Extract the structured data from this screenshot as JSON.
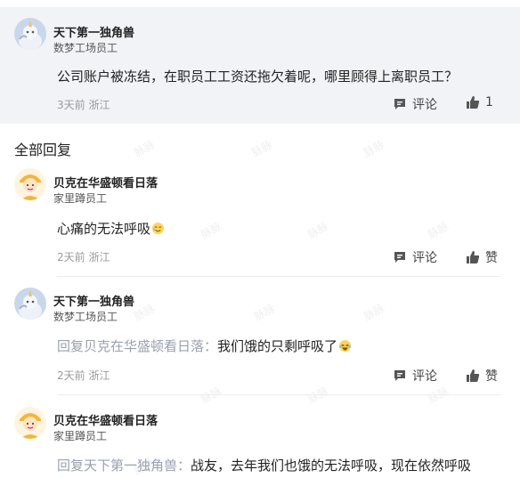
{
  "post": {
    "author": "天下第一独角兽",
    "company": "数梦工场员工",
    "text": "公司账户被冻结，在职员工工资还拖欠着呢，哪里顾得上离职员工？",
    "time": "3天前",
    "location": "浙江",
    "comment_label": "评论",
    "like_count": "1"
  },
  "section_title": "全部回复",
  "watermark": "脉脉",
  "replies": [
    {
      "author": "贝克在华盛顿看日落",
      "company": "家里蹲员工",
      "prefix": "",
      "text": "心痛的无法呼吸",
      "time": "2天前",
      "location": "浙江",
      "comment_label": "评论",
      "like_label": "赞"
    },
    {
      "author": "天下第一独角兽",
      "company": "数梦工场员工",
      "prefix": "回复贝克在华盛顿看日落：",
      "text": "我们饿的只剩呼吸了",
      "time": "2天前",
      "location": "浙江",
      "comment_label": "评论",
      "like_label": "赞"
    },
    {
      "author": "贝克在华盛顿看日落",
      "company": "家里蹲员工",
      "prefix": "回复天下第一独角兽：",
      "text": "战友，去年我们也饿的无法呼吸，现在依然呼吸"
    }
  ]
}
